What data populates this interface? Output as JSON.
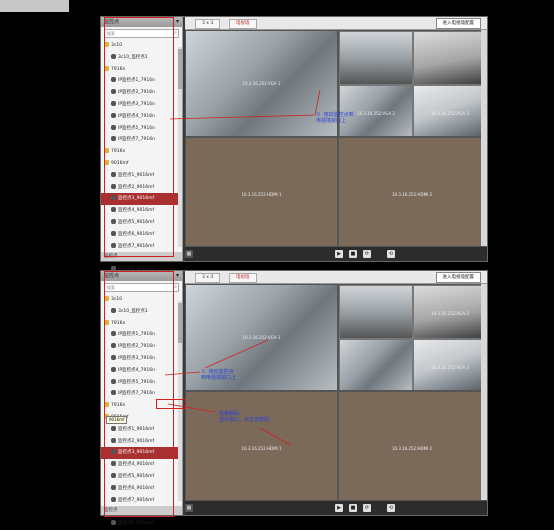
{
  "panel1": {
    "sidebar": {
      "title": "监控点",
      "search_placeholder": "搜索",
      "items": [
        {
          "label": "3c10",
          "level": 0,
          "icon": "folder-icon"
        },
        {
          "label": "3c10_监控点1",
          "level": 1,
          "icon": "camera-icon"
        },
        {
          "label": "7916n",
          "level": 0,
          "icon": "folder-icon"
        },
        {
          "label": "IP监控点1_7916n",
          "level": 1,
          "icon": "camera-icon"
        },
        {
          "label": "IP监控点2_7916n",
          "level": 1,
          "icon": "camera-icon"
        },
        {
          "label": "IP监控点3_7916n",
          "level": 1,
          "icon": "camera-icon"
        },
        {
          "label": "IP监控点4_7916n",
          "level": 1,
          "icon": "camera-icon"
        },
        {
          "label": "IP监控点5_7916n",
          "level": 1,
          "icon": "camera-icon"
        },
        {
          "label": "IP监控点7_7916n",
          "level": 1,
          "icon": "camera-icon"
        },
        {
          "label": "7916n",
          "level": 0,
          "icon": "folder-icon"
        },
        {
          "label": "9016mf",
          "level": 0,
          "icon": "folder-icon"
        },
        {
          "label": "监控点1_9016mf",
          "level": 1,
          "icon": "camera-icon"
        },
        {
          "label": "监控点2_9016mf",
          "level": 1,
          "icon": "camera-icon"
        },
        {
          "label": "监控点3_9016mf",
          "level": 1,
          "icon": "camera-icon",
          "selected": true
        },
        {
          "label": "监控点4_9016mf",
          "level": 1,
          "icon": "camera-icon"
        },
        {
          "label": "监控点5_9016mf",
          "level": 1,
          "icon": "camera-icon"
        },
        {
          "label": "监控点6_9016mf",
          "level": 1,
          "icon": "camera-icon"
        },
        {
          "label": "监控点7_9016mf",
          "level": 1,
          "icon": "camera-icon"
        },
        {
          "label": "监控点8_9016mf",
          "level": 1,
          "icon": "camera-icon"
        },
        {
          "label": "监控点9_9016mf",
          "level": 1,
          "icon": "camera-icon"
        }
      ],
      "footer": "监控点"
    },
    "tabs": [
      "3 x 3",
      "电视墙"
    ],
    "wall_button": "进入电视墙配置",
    "tiles": [
      "10.3.16.252:VGA 1",
      "10.3.16.252:VGA 2",
      "10.3.16.252:VGA 3",
      "10.3.16.252:HDMI 1",
      "10.3.16.252:HDMI 2"
    ],
    "annotation": "①. 拖动监控点到\n电视墙窗口上"
  },
  "panel2": {
    "sidebar": {
      "title": "监控点",
      "search_placeholder": "搜索",
      "items": [
        {
          "label": "3c10",
          "level": 0,
          "icon": "folder-icon"
        },
        {
          "label": "3c10_监控点1",
          "level": 1,
          "icon": "camera-icon"
        },
        {
          "label": "7916n",
          "level": 0,
          "icon": "folder-icon"
        },
        {
          "label": "IP监控点1_7916n",
          "level": 1,
          "icon": "camera-icon"
        },
        {
          "label": "IP监控点2_7916n",
          "level": 1,
          "icon": "camera-icon"
        },
        {
          "label": "IP监控点3_7916n",
          "level": 1,
          "icon": "camera-icon"
        },
        {
          "label": "IP监控点4_7916n",
          "level": 1,
          "icon": "camera-icon"
        },
        {
          "label": "IP监控点5_7916n",
          "level": 1,
          "icon": "camera-icon"
        },
        {
          "label": "IP监控点7_7916n",
          "level": 1,
          "icon": "camera-icon"
        },
        {
          "label": "7916n",
          "level": 0,
          "icon": "folder-icon"
        },
        {
          "label": "9016mf",
          "level": 0,
          "icon": "folder-icon"
        },
        {
          "label": "监控点1_9016mf",
          "level": 1,
          "icon": "camera-icon"
        },
        {
          "label": "监控点2_9016mf",
          "level": 1,
          "icon": "camera-icon"
        },
        {
          "label": "监控点3_9016mf",
          "level": 1,
          "icon": "camera-icon",
          "selected": true
        },
        {
          "label": "监控点4_9016mf",
          "level": 1,
          "icon": "camera-icon"
        },
        {
          "label": "监控点5_9016mf",
          "level": 1,
          "icon": "camera-icon"
        },
        {
          "label": "监控点6_9016mf",
          "level": 1,
          "icon": "camera-icon"
        },
        {
          "label": "监控点7_9016mf",
          "level": 1,
          "icon": "camera-icon"
        },
        {
          "label": "监控点8_9016mf",
          "level": 1,
          "icon": "camera-icon"
        },
        {
          "label": "监控点9_9016mf",
          "level": 1,
          "icon": "camera-icon"
        }
      ],
      "footer": "监控点",
      "tooltip": "9016mf"
    },
    "tabs": [
      "3 x 3",
      "电视墙"
    ],
    "wall_button": "进入电视墙配置",
    "tiles": [
      "10.3.16.252:VGA 1",
      "10.3.16.252:VGA 2",
      "10.3.16.252:VGA 3",
      "10.3.16.252:HDMI 1",
      "10.3.16.252:HDMI 2"
    ],
    "annotation": "①. 拖动监控点\n到电视墙窗口上",
    "annotation2": "批量解码:\n选中窗口，点击该按钮"
  },
  "colors": {
    "selected": "#a83030",
    "annotation": "#2a3fd8",
    "highlight": "#d02020"
  }
}
